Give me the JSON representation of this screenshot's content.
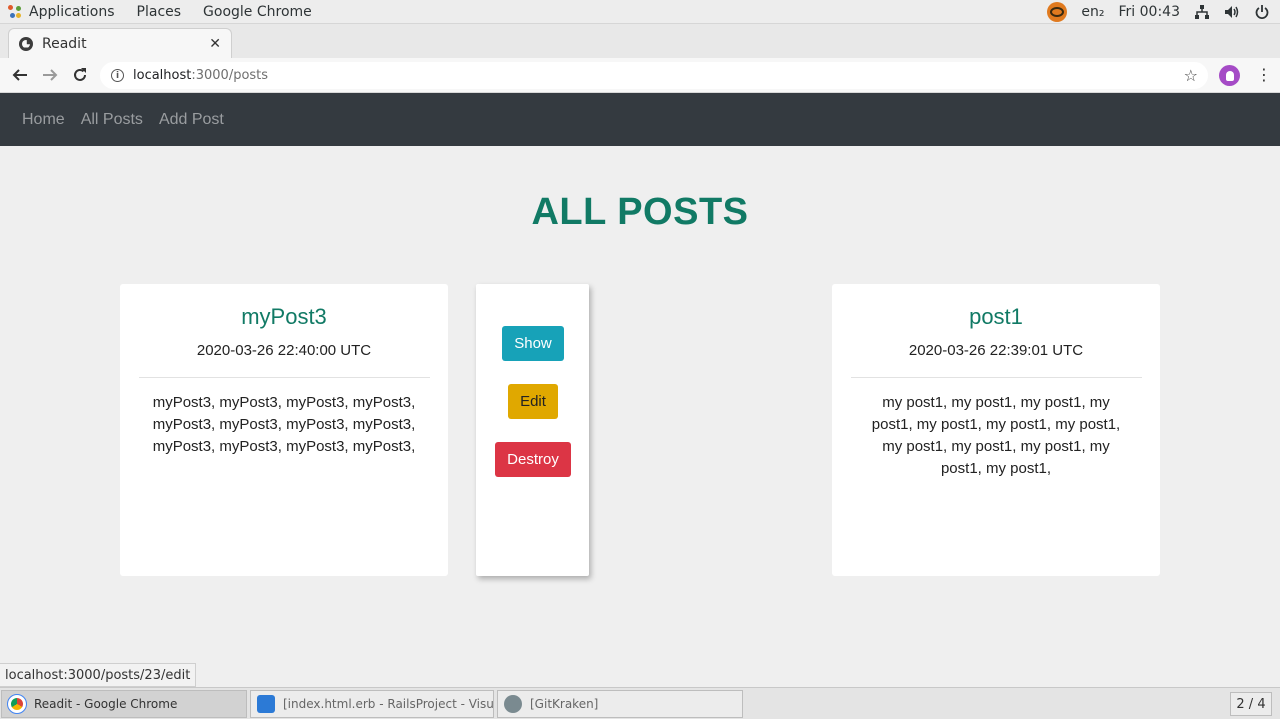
{
  "system_bar": {
    "menus": [
      "Applications",
      "Places",
      "Google Chrome"
    ],
    "keyboard_layout": "en₂",
    "clock": "Fri 00:43",
    "icons": [
      "network-icon",
      "volume-icon",
      "power-icon"
    ]
  },
  "browser": {
    "tab_title": "Readit",
    "tab_close": "✕",
    "new_tab": "+",
    "window_controls": [
      "–",
      "▫",
      "✕"
    ],
    "url_host": "localhost",
    "url_path": ":3000/posts",
    "status_link": "localhost:3000/posts/23/edit"
  },
  "site": {
    "nav": [
      "Home",
      "All Posts",
      "Add Post"
    ],
    "heading": "ALL POSTS",
    "posts": [
      {
        "title": "myPost3",
        "date": "2020-03-26 22:40:00 UTC",
        "body": "myPost3, myPost3, myPost3, myPost3, myPost3, myPost3, myPost3, myPost3, myPost3, myPost3, myPost3, myPost3,"
      },
      {
        "title": "post1",
        "date": "2020-03-26 22:39:01 UTC",
        "body": "my post1, my post1, my post1, my post1, my post1, my post1, my post1, my post1, my post1, my post1, my post1, my post1,"
      }
    ],
    "actions": {
      "show": "Show",
      "edit": "Edit",
      "destroy": "Destroy"
    }
  },
  "colors": {
    "accent_green": "#117a65",
    "navbar": "#343a40",
    "show": "#17a2b8",
    "edit": "#e0a800",
    "destroy": "#dc3545"
  },
  "taskbar": {
    "tasks": [
      "Readit - Google Chrome",
      "[index.html.erb - RailsProject - Visual...",
      "[GitKraken]"
    ],
    "workspace": "2 / 4"
  }
}
